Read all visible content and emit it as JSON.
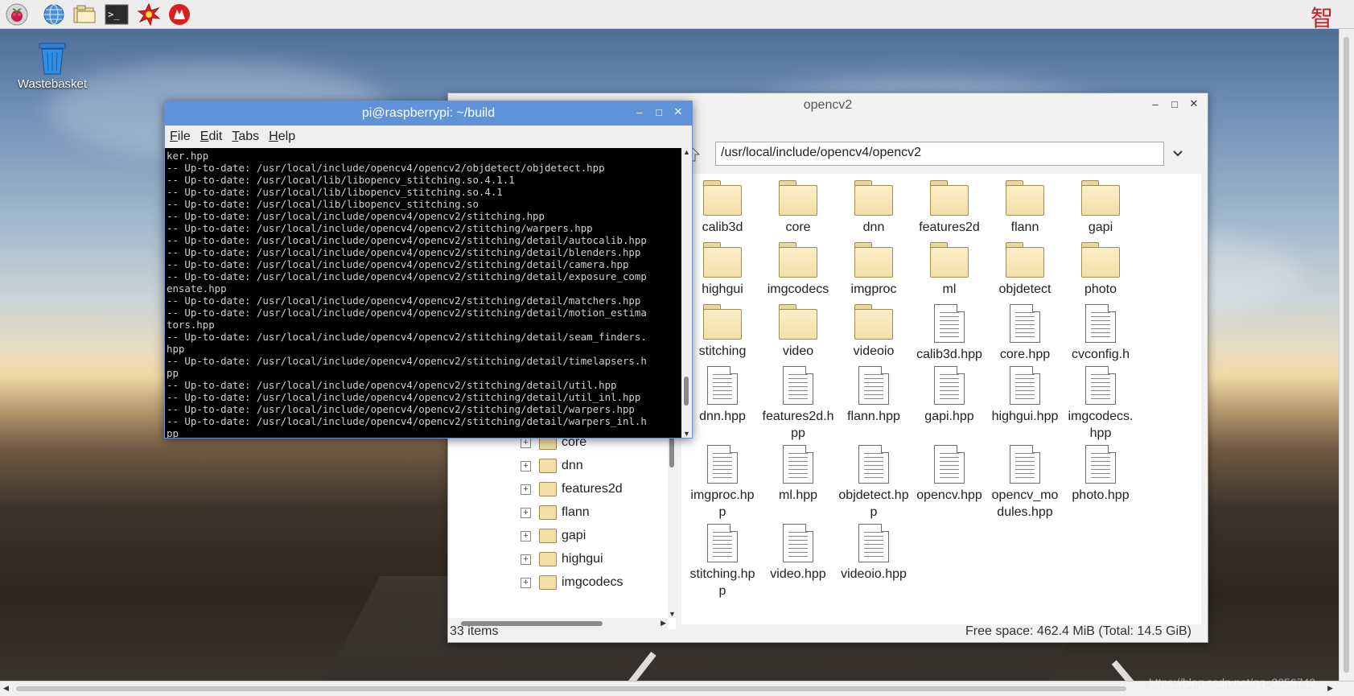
{
  "taskbar": {
    "icons": [
      "raspberry-menu-icon",
      "web-browser-icon",
      "file-manager-icon",
      "terminal-icon",
      "math-icon",
      "wolfram-icon"
    ],
    "corner_glyph": "智"
  },
  "desktop": {
    "wastebasket_label": "Wastebasket",
    "watermark": "https://blog.csdn.net/qq_3056742"
  },
  "file_manager": {
    "title": "opencv2",
    "path": "/usr/local/include/opencv4/opencv2",
    "tree_items": [
      "core",
      "dnn",
      "features2d",
      "flann",
      "gapi",
      "highgui",
      "imgcodecs"
    ],
    "items": [
      {
        "name": "calib3d",
        "type": "folder"
      },
      {
        "name": "core",
        "type": "folder"
      },
      {
        "name": "dnn",
        "type": "folder"
      },
      {
        "name": "features2d",
        "type": "folder"
      },
      {
        "name": "flann",
        "type": "folder"
      },
      {
        "name": "gapi",
        "type": "folder"
      },
      {
        "name": "highgui",
        "type": "folder"
      },
      {
        "name": "imgcodecs",
        "type": "folder"
      },
      {
        "name": "imgproc",
        "type": "folder"
      },
      {
        "name": "ml",
        "type": "folder"
      },
      {
        "name": "objdetect",
        "type": "folder"
      },
      {
        "name": "photo",
        "type": "folder"
      },
      {
        "name": "stitching",
        "type": "folder"
      },
      {
        "name": "video",
        "type": "folder"
      },
      {
        "name": "videoio",
        "type": "folder"
      },
      {
        "name": "calib3d.hpp",
        "type": "file"
      },
      {
        "name": "core.hpp",
        "type": "file"
      },
      {
        "name": "cvconfig.h",
        "type": "file"
      },
      {
        "name": "dnn.hpp",
        "type": "file"
      },
      {
        "name": "features2d.h\npp",
        "type": "file"
      },
      {
        "name": "flann.hpp",
        "type": "file"
      },
      {
        "name": "gapi.hpp",
        "type": "file"
      },
      {
        "name": "highgui.hpp",
        "type": "file"
      },
      {
        "name": "imgcodecs.\nhpp",
        "type": "file"
      },
      {
        "name": "imgproc.hp\np",
        "type": "file"
      },
      {
        "name": "ml.hpp",
        "type": "file"
      },
      {
        "name": "objdetect.hp\np",
        "type": "file"
      },
      {
        "name": "opencv.hpp",
        "type": "file"
      },
      {
        "name": "opencv_mo\ndules.hpp",
        "type": "file"
      },
      {
        "name": "photo.hpp",
        "type": "file"
      },
      {
        "name": "stitching.hp\np",
        "type": "file"
      },
      {
        "name": "video.hpp",
        "type": "file"
      },
      {
        "name": "videoio.hpp",
        "type": "file"
      }
    ],
    "status_left": "33 items",
    "status_right": "Free space: 462.4 MiB (Total: 14.5 GiB)"
  },
  "terminal": {
    "title": "pi@raspberrypi: ~/build",
    "menu": [
      {
        "label": "File",
        "mnemonic": "F"
      },
      {
        "label": "Edit",
        "mnemonic": "E"
      },
      {
        "label": "Tabs",
        "mnemonic": "T"
      },
      {
        "label": "Help",
        "mnemonic": "H"
      }
    ],
    "lines": [
      "ker.hpp",
      "-- Up-to-date: /usr/local/include/opencv4/opencv2/objdetect/objdetect.hpp",
      "-- Up-to-date: /usr/local/lib/libopencv_stitching.so.4.1.1",
      "-- Up-to-date: /usr/local/lib/libopencv_stitching.so.4.1",
      "-- Up-to-date: /usr/local/lib/libopencv_stitching.so",
      "-- Up-to-date: /usr/local/include/opencv4/opencv2/stitching.hpp",
      "-- Up-to-date: /usr/local/include/opencv4/opencv2/stitching/warpers.hpp",
      "-- Up-to-date: /usr/local/include/opencv4/opencv2/stitching/detail/autocalib.hpp",
      "-- Up-to-date: /usr/local/include/opencv4/opencv2/stitching/detail/blenders.hpp",
      "-- Up-to-date: /usr/local/include/opencv4/opencv2/stitching/detail/camera.hpp",
      "-- Up-to-date: /usr/local/include/opencv4/opencv2/stitching/detail/exposure_comp",
      "ensate.hpp",
      "-- Up-to-date: /usr/local/include/opencv4/opencv2/stitching/detail/matchers.hpp",
      "-- Up-to-date: /usr/local/include/opencv4/opencv2/stitching/detail/motion_estima",
      "tors.hpp",
      "-- Up-to-date: /usr/local/include/opencv4/opencv2/stitching/detail/seam_finders.",
      "hpp",
      "-- Up-to-date: /usr/local/include/opencv4/opencv2/stitching/detail/timelapsers.h",
      "pp",
      "-- Up-to-date: /usr/local/include/opencv4/opencv2/stitching/detail/util.hpp",
      "-- Up-to-date: /usr/local/include/opencv4/opencv2/stitching/detail/util_inl.hpp",
      "-- Up-to-date: /usr/local/include/opencv4/opencv2/stitching/detail/warpers.hpp",
      "-- Up-to-date: /usr/local/include/opencv4/opencv2/stitching/detail/warpers_inl.h",
      "pp"
    ]
  }
}
